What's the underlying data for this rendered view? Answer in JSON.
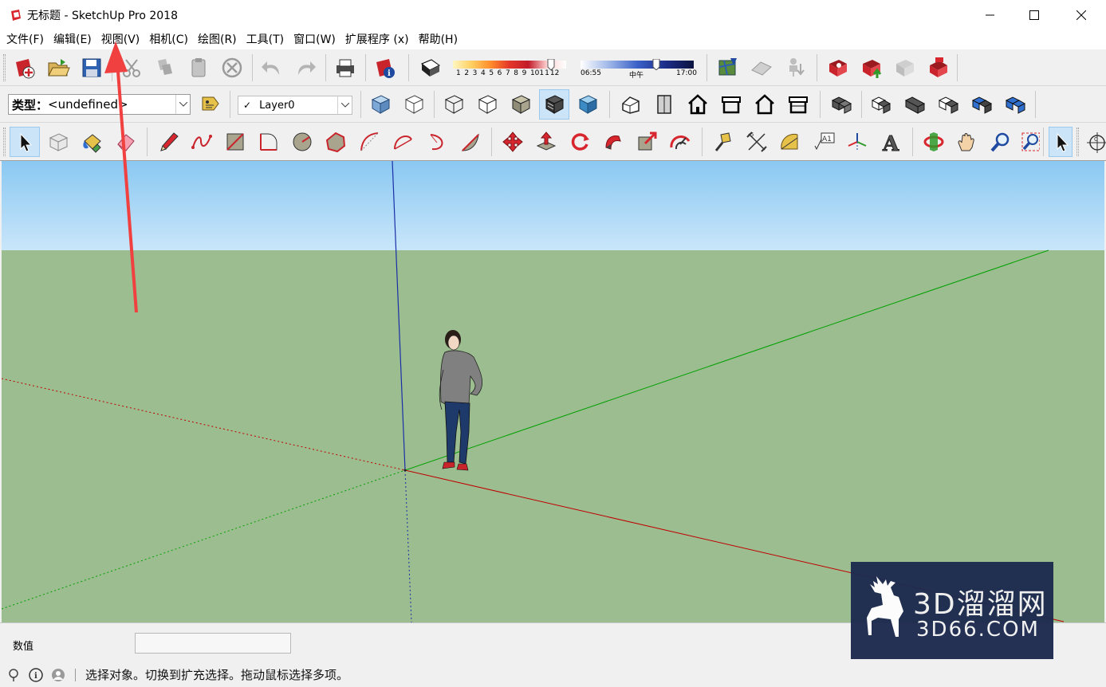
{
  "window": {
    "title": "无标题 - SketchUp Pro 2018",
    "controls": [
      "minimize",
      "maximize",
      "close"
    ]
  },
  "menu": [
    "文件(F)",
    "编辑(E)",
    "视图(V)",
    "相机(C)",
    "绘图(R)",
    "工具(T)",
    "窗口(W)",
    "扩展程序 (x)",
    "帮助(H)"
  ],
  "shadow": {
    "months": [
      "1",
      "2",
      "3",
      "4",
      "5",
      "6",
      "7",
      "8",
      "9",
      "10",
      "11",
      "12"
    ],
    "time_start": "06:55",
    "time_mid": "中午",
    "time_end": "17:00"
  },
  "type_combo": {
    "label": "类型：",
    "value": "<undefined>"
  },
  "layer_combo": {
    "check": "✓",
    "value": "Layer0"
  },
  "vcb": {
    "label": "数值",
    "value": ""
  },
  "status": {
    "text": "选择对象。切换到扩充选择。拖动鼠标选择多项。"
  },
  "watermark": {
    "main": "3D溜溜网",
    "sub": "3D66.COM"
  },
  "colors": {
    "sky_top": "#8ac8f2",
    "ground": "#9bbd8f",
    "axis_red": "#c00000",
    "axis_green": "#00a000",
    "axis_blue": "#1a2ea8",
    "annotation_arrow": "#f04040"
  },
  "active_tool": "select-tool"
}
